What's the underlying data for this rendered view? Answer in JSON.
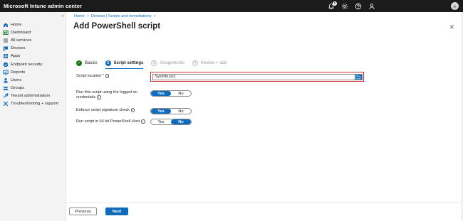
{
  "app": {
    "title": "Microsoft Intune admin center"
  },
  "topbar": {
    "notification_count": "1",
    "icons": [
      "bell-icon",
      "gear-icon",
      "help-icon",
      "feedback-icon"
    ]
  },
  "sidebar": {
    "collapse_glyph": "«",
    "items": [
      {
        "label": "Home",
        "icon": "home-icon",
        "color": "#0f6cbd"
      },
      {
        "label": "Dashboard",
        "icon": "dashboard-icon",
        "color": "#107c10"
      },
      {
        "label": "All services",
        "icon": "all-services-icon",
        "color": "#555555"
      },
      {
        "label": "Devices",
        "icon": "devices-icon",
        "color": "#0f6cbd"
      },
      {
        "label": "Apps",
        "icon": "apps-icon",
        "color": "#0f6cbd"
      },
      {
        "label": "Endpoint security",
        "icon": "endpoint-security-icon",
        "color": "#0f6cbd"
      },
      {
        "label": "Reports",
        "icon": "reports-icon",
        "color": "#0f6cbd"
      },
      {
        "label": "Users",
        "icon": "users-icon",
        "color": "#0f6cbd"
      },
      {
        "label": "Groups",
        "icon": "groups-icon",
        "color": "#0f6cbd"
      },
      {
        "label": "Tenant administration",
        "icon": "tenant-admin-icon",
        "color": "#0f6cbd"
      },
      {
        "label": "Troubleshooting + support",
        "icon": "troubleshooting-icon",
        "color": "#0f6cbd"
      }
    ]
  },
  "breadcrumb": {
    "items": [
      "Home",
      "Devices | Scripts and remediations"
    ],
    "separator": ">"
  },
  "page": {
    "title": "Add PowerShell script",
    "more": "···",
    "close": "✕"
  },
  "steps": [
    {
      "label": "Basics",
      "state": "done",
      "marker": "✓"
    },
    {
      "label": "Script settings",
      "state": "current",
      "marker": "2"
    },
    {
      "label": "Assignments",
      "state": "pending",
      "marker": "3"
    },
    {
      "label": "Review + add",
      "state": "pending",
      "marker": "4"
    }
  ],
  "form": {
    "script_location": {
      "label": "Script location *",
      "value": "SysInfo.ps1"
    },
    "run_logged_on": {
      "label_line1": "Run this script using the logged on",
      "label_line2": "credentials",
      "yes": "Yes",
      "no": "No",
      "selected": "Yes"
    },
    "enforce_signature": {
      "label": "Enforce script signature check",
      "yes": "Yes",
      "no": "No",
      "selected": "Yes"
    },
    "run_64bit": {
      "label": "Run script in 64 bit PowerShell Host",
      "yes": "Yes",
      "no": "No",
      "selected": "No"
    }
  },
  "footer": {
    "previous_label": "Previous",
    "next_label": "Next"
  },
  "colors": {
    "accent": "#0f6cbd",
    "success": "#107c10",
    "error_outline": "#d13438",
    "topbar": "#1b1b1b"
  }
}
